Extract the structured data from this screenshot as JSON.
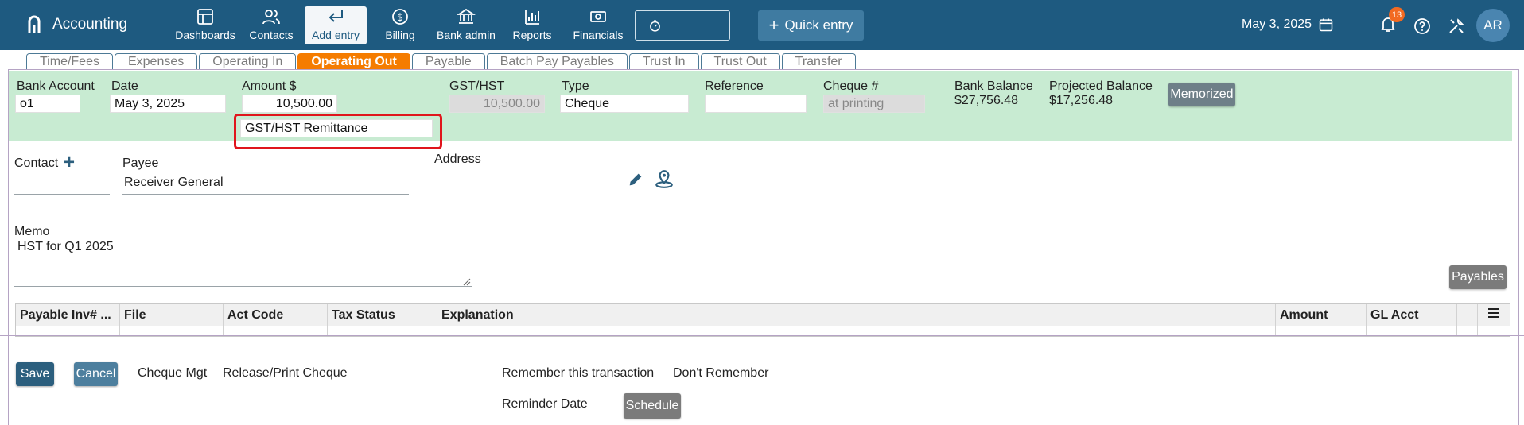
{
  "app": {
    "name": "Accounting"
  },
  "nav": [
    {
      "label": "Dashboards",
      "icon": "dashboard-icon"
    },
    {
      "label": "Contacts",
      "icon": "contacts-icon"
    },
    {
      "label": "Add entry",
      "icon": "enter-arrow-icon",
      "active": true
    },
    {
      "label": "Billing",
      "icon": "dollar-icon"
    },
    {
      "label": "Bank admin",
      "icon": "bank-icon"
    },
    {
      "label": "Reports",
      "icon": "bar-chart-icon"
    },
    {
      "label": "Financials",
      "icon": "money-icon"
    }
  ],
  "quick_entry": {
    "label": "Quick entry"
  },
  "top_date": "May 3, 2025",
  "notifications": {
    "count": "13"
  },
  "user": {
    "initials": "AR"
  },
  "tabs": [
    "Time/Fees",
    "Expenses",
    "Operating In",
    "Operating Out",
    "Payable",
    "Batch Pay Payables",
    "Trust In",
    "Trust Out",
    "Transfer"
  ],
  "active_tab": "Operating Out",
  "form": {
    "bank_account_label": "Bank Account",
    "bank_account_value": "o1",
    "date_label": "Date",
    "date_value": "May 3, 2025",
    "amount_label": "Amount $",
    "amount_value": "10,500.00",
    "category_value": "GST/HST Remittance",
    "gst_label": "GST/HST",
    "gst_value": "10,500.00",
    "type_label": "Type",
    "type_value": "Cheque",
    "reference_label": "Reference",
    "reference_value": "",
    "cheque_label": "Cheque #",
    "cheque_value": "at printing",
    "bank_balance_label": "Bank Balance",
    "bank_balance_value": "$27,756.48",
    "projected_balance_label": "Projected Balance",
    "projected_balance_value": "$17,256.48",
    "memorized_label": "Memorized",
    "contact_label": "Contact",
    "payee_label": "Payee",
    "payee_value": "Receiver General",
    "address_label": "Address",
    "memo_label": "Memo",
    "memo_value": "HST for Q1 2025",
    "payables_button": "Payables"
  },
  "table": {
    "columns": [
      "Payable Inv# ...",
      "File",
      "Act Code",
      "Tax Status",
      "Explanation",
      "Amount",
      "GL Acct"
    ]
  },
  "footer": {
    "save": "Save",
    "cancel": "Cancel",
    "cheque_mgt_label": "Cheque Mgt",
    "cheque_mgt_value": "Release/Print Cheque",
    "remember_label": "Remember this transaction",
    "remember_value": "Don't Remember",
    "reminder_label": "Reminder Date",
    "schedule_button": "Schedule"
  },
  "colors": {
    "topbar": "#1e5a80",
    "active_tab": "#f57c00",
    "green_panel": "#c8ebd2",
    "highlight": "#e0151c"
  }
}
